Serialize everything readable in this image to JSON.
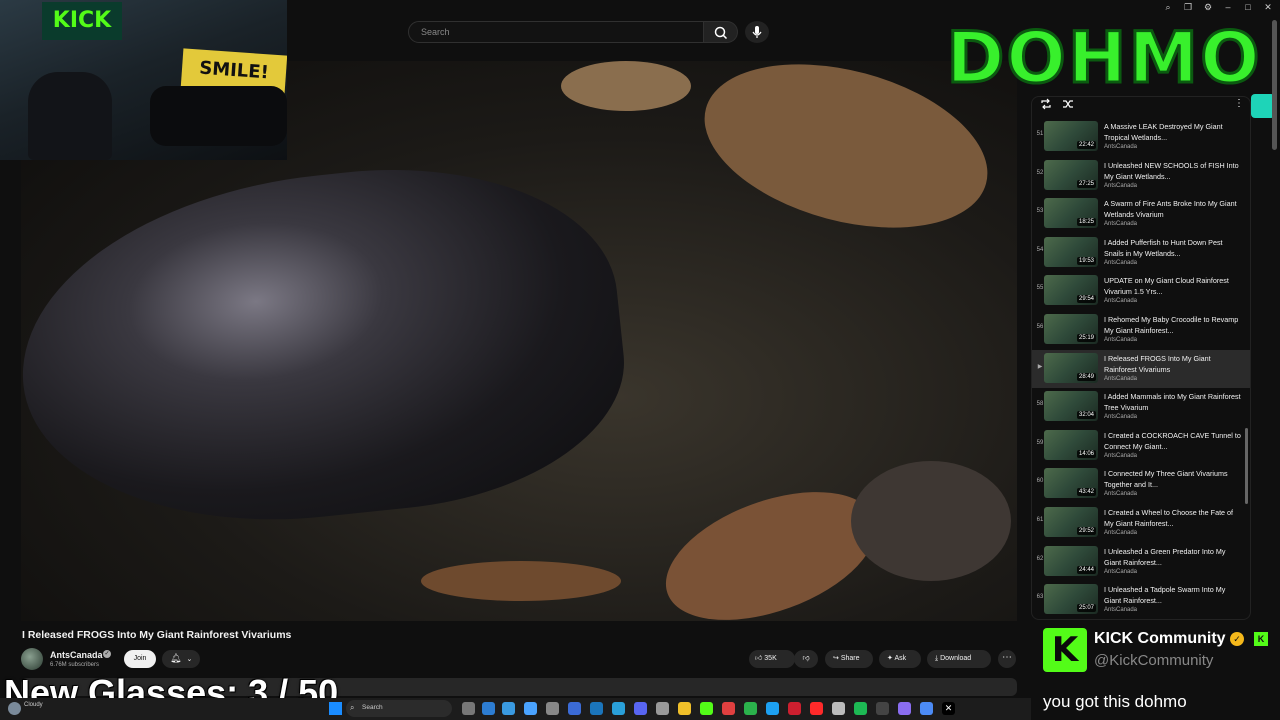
{
  "search": {
    "placeholder": "Search"
  },
  "video": {
    "title": "I Released FROGS Into My Giant Rainforest Vivariums",
    "channel": "AntsCanada",
    "subscribers": "6.76M subscribers",
    "join_label": "Join",
    "like_count": "35K",
    "share_label": "Share",
    "ask_label": "Ask",
    "download_label": "Download"
  },
  "overlay": {
    "logo_text": "DOHMO",
    "glasses_label": "New Glasses:  3 / 50",
    "webcam_sign_left": "KICK",
    "webcam_sign_right": "SMILE!"
  },
  "playlist": {
    "items": [
      {
        "index": "51",
        "title": "A Massive LEAK Destroyed My Giant Tropical Wetlands...",
        "channel": "AntsCanada",
        "duration": "22:42",
        "active": false
      },
      {
        "index": "52",
        "title": "I Unleashed NEW SCHOOLS of FISH Into My Giant Wetlands...",
        "channel": "AntsCanada",
        "duration": "27:25",
        "active": false
      },
      {
        "index": "53",
        "title": "A Swarm of Fire Ants Broke Into My Giant Wetlands Vivarium",
        "channel": "AntsCanada",
        "duration": "18:25",
        "active": false
      },
      {
        "index": "54",
        "title": "I Added Pufferfish to Hunt Down Pest Snails in My Wetlands...",
        "channel": "AntsCanada",
        "duration": "19:53",
        "active": false
      },
      {
        "index": "55",
        "title": "UPDATE on My Giant Cloud Rainforest Vivarium 1.5 Yrs...",
        "channel": "AntsCanada",
        "duration": "29:54",
        "active": false
      },
      {
        "index": "56",
        "title": "I Rehomed My Baby Crocodile to Revamp My Giant Rainforest...",
        "channel": "AntsCanada",
        "duration": "25:19",
        "active": false
      },
      {
        "index": "▶",
        "title": "I Released FROGS Into My Giant Rainforest Vivariums",
        "channel": "AntsCanada",
        "duration": "28:49",
        "active": true
      },
      {
        "index": "58",
        "title": "I Added Mammals into My Giant Rainforest Tree Vivarium",
        "channel": "AntsCanada",
        "duration": "32:04",
        "active": false
      },
      {
        "index": "59",
        "title": "I Created a COCKROACH CAVE Tunnel to Connect My Giant...",
        "channel": "AntsCanada",
        "duration": "14:06",
        "active": false
      },
      {
        "index": "60",
        "title": "I Connected My Three Giant Vivariums Together and It...",
        "channel": "AntsCanada",
        "duration": "43:42",
        "active": false
      },
      {
        "index": "61",
        "title": "I Created a Wheel to Choose the Fate of My Giant Rainforest...",
        "channel": "AntsCanada",
        "duration": "29:52",
        "active": false
      },
      {
        "index": "62",
        "title": "I Unleashed a Green Predator Into My Giant Rainforest...",
        "channel": "AntsCanada",
        "duration": "24:44",
        "active": false
      },
      {
        "index": "63",
        "title": "I Unleashed a Tadpole Swarm Into My Giant Rainforest...",
        "channel": "AntsCanada",
        "duration": "25:07",
        "active": false
      }
    ]
  },
  "taskbar": {
    "weather": "Cloudy",
    "search_label": "Search"
  },
  "chat": {
    "title": "KICK Community",
    "handle": "@KickCommunity",
    "message": "you got this dohmo",
    "logo_letter": "K"
  },
  "colors": {
    "kick_green": "#53fc18",
    "logo_green": "#38f02c",
    "bg": "#0f0f0f"
  }
}
